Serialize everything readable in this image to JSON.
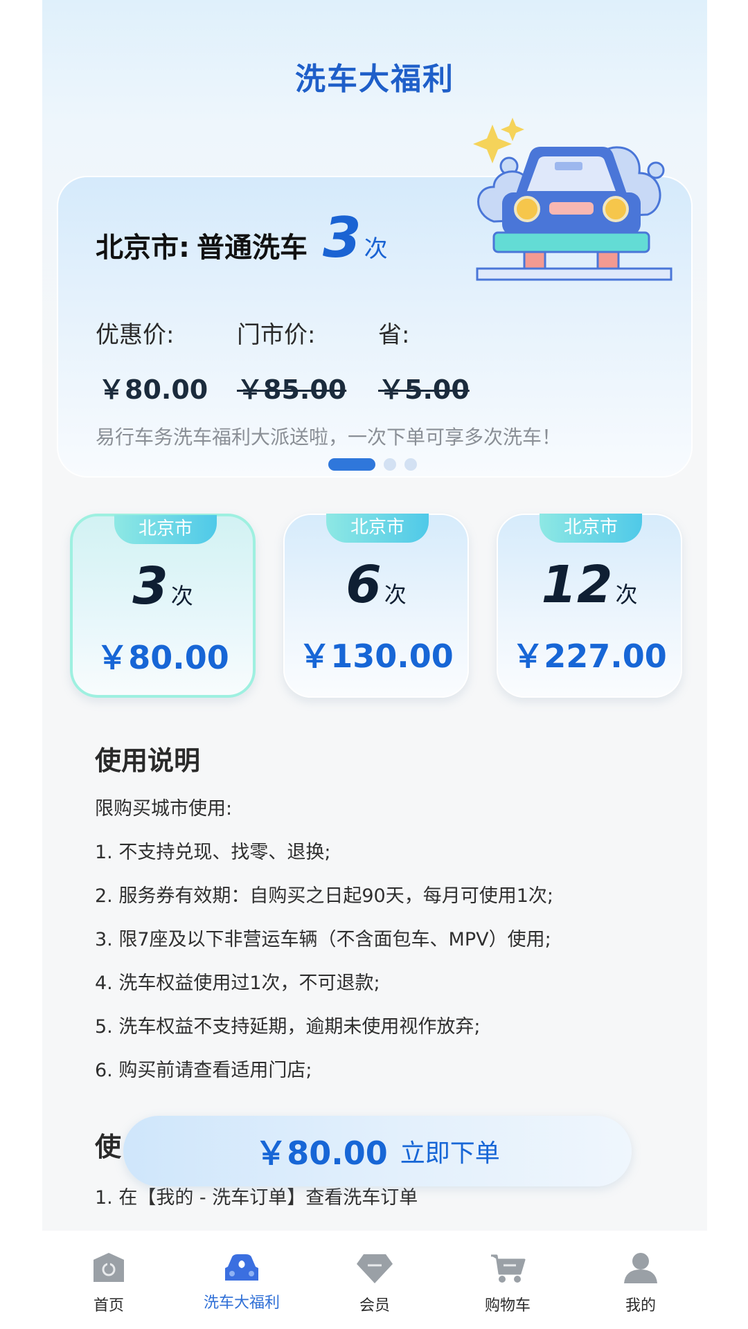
{
  "header": {
    "title": "洗车大福利"
  },
  "hero": {
    "city": "北京市:",
    "service": "普通洗车",
    "count": "3",
    "unit": "次",
    "discount_label": "优惠价:",
    "discount_price": "￥80.00",
    "store_label": "门市价:",
    "store_price": "￥85.00",
    "save_label": "省:",
    "save_price": "￥5.00",
    "description": "易行车务洗车福利大派送啦，一次下单可享多次洗车！",
    "carousel_index": 1,
    "carousel_total": 3
  },
  "packages": [
    {
      "city": "北京市",
      "count": "3",
      "unit": "次",
      "price": "￥80.00",
      "selected": true
    },
    {
      "city": "北京市",
      "count": "6",
      "unit": "次",
      "price": "￥130.00",
      "selected": false
    },
    {
      "city": "北京市",
      "count": "12",
      "unit": "次",
      "price": "￥227.00",
      "selected": false
    }
  ],
  "usage": {
    "title": "使用说明",
    "intro": "限购买城市使用:",
    "rules": [
      "1. 不支持兑现、找零、退换;",
      "2. 服务券有效期：自购买之日起90天，每月可使用1次;",
      "3. 限7座及以下非营运车辆（不含面包车、MPV）使用;",
      "4. 洗车权益使用过1次，不可退款;",
      "5. 洗车权益不支持延期，逾期未使用视作放弃;",
      "6. 购买前请查看适用门店;"
    ]
  },
  "process": {
    "title_partial": "使",
    "step1": "1. 在【我的 - 洗车订单】查看洗车订单"
  },
  "order_bar": {
    "price": "￥80.00",
    "button": "立即下单"
  },
  "tabbar": {
    "items": [
      {
        "label": "首页",
        "icon": "home-icon"
      },
      {
        "label": "洗车大福利",
        "icon": "car-wash-icon",
        "active": true
      },
      {
        "label": "会员",
        "icon": "diamond-icon"
      },
      {
        "label": "购物车",
        "icon": "cart-icon"
      },
      {
        "label": "我的",
        "icon": "user-icon"
      }
    ]
  },
  "colors": {
    "accent": "#1766d6",
    "title": "#1f5fc9",
    "tag": "#4fc9e8",
    "selected_border": "#9ef0e0"
  }
}
